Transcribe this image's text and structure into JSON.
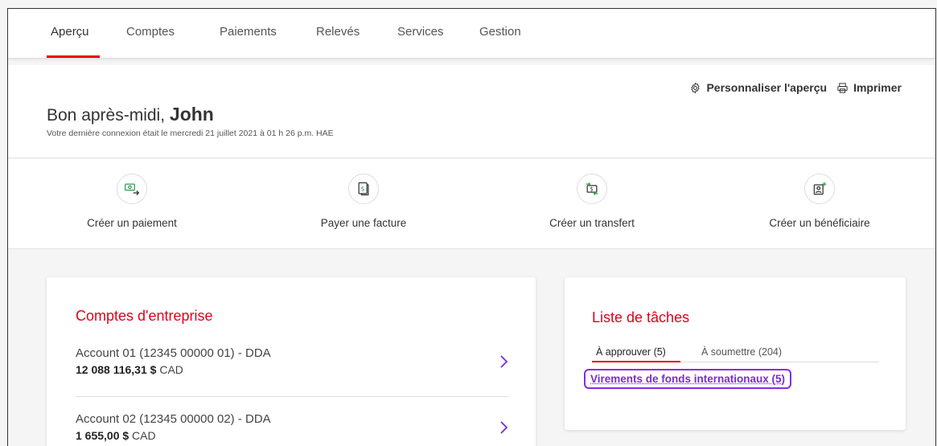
{
  "nav": {
    "tabs": [
      {
        "label": "Aperçu",
        "active": true
      },
      {
        "label": "Comptes"
      },
      {
        "label": "Paiements"
      },
      {
        "label": "Relevés"
      },
      {
        "label": "Services"
      },
      {
        "label": "Gestion"
      }
    ]
  },
  "greeting": {
    "hello": "Bon après-midi, ",
    "name": "John",
    "last_login": "Votre dernière connexion était le mercredi 21 juillet 2021 à 01 h 26 p.m. HAE",
    "customize_label": "Personnaliser l'aperçu",
    "print_label": "Imprimer"
  },
  "quick_actions": [
    {
      "label": "Créer un paiement",
      "icon": "payment-icon"
    },
    {
      "label": "Payer une facture",
      "icon": "bill-icon"
    },
    {
      "label": "Créer un transfert",
      "icon": "transfer-icon"
    },
    {
      "label": "Créer un bénéficiaire",
      "icon": "add-beneficiary-icon"
    }
  ],
  "accounts": {
    "title": "Comptes d'entreprise",
    "items": [
      {
        "name": "Account 01 (12345 00000 01) - DDA",
        "amount": "12 088 116,31 $",
        "currency": " CAD"
      },
      {
        "name": "Account 02 (12345 00000 02) - DDA",
        "amount": "1 655,00 $",
        "currency": " CAD"
      }
    ]
  },
  "tasks": {
    "title": "Liste de tâches",
    "tabs": [
      {
        "label": "À approuver (5)",
        "active": true
      },
      {
        "label": "À soumettre (204)"
      }
    ],
    "link": "Virements de fonds internationaux (5)"
  },
  "colors": {
    "brand_red": "#e2001a",
    "highlight_purple": "#8a2be2",
    "link_purple": "#7a2bd6"
  }
}
